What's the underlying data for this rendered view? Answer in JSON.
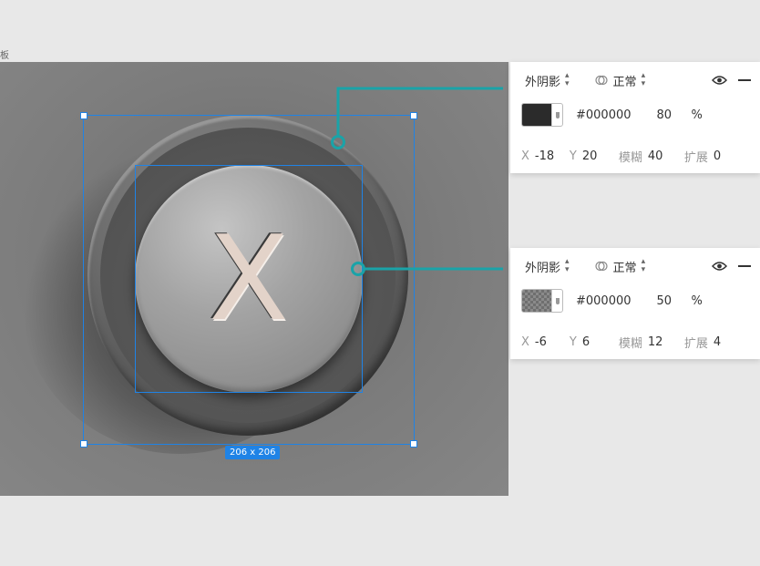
{
  "artboard": {
    "label": "板"
  },
  "canvas": {
    "button_letter": "X",
    "dimension_badge": "206 x 206"
  },
  "panels": [
    {
      "type_label": "外阴影",
      "blend_label": "正常",
      "color_hex": "#000000",
      "opacity": "80",
      "percent": "%",
      "x_label": "X",
      "x_value": "-18",
      "y_label": "Y",
      "y_value": "20",
      "blur_label": "模糊",
      "blur_value": "40",
      "spread_label": "扩展",
      "spread_value": "0",
      "swatch": "solid-dark"
    },
    {
      "type_label": "外阴影",
      "blend_label": "正常",
      "color_hex": "#000000",
      "opacity": "50",
      "percent": "%",
      "x_label": "X",
      "x_value": "-6",
      "y_label": "Y",
      "y_value": "6",
      "blur_label": "模糊",
      "blur_value": "12",
      "spread_label": "扩展",
      "spread_value": "4",
      "swatch": "checker"
    }
  ],
  "colors": {
    "selection": "#1f83e6",
    "connector": "#1aa3a8",
    "canvas": "#7a7a7a"
  },
  "icons": [
    "updown-icon",
    "blend-mode-icon",
    "eye-icon",
    "minus-icon",
    "dropdown-icon"
  ]
}
